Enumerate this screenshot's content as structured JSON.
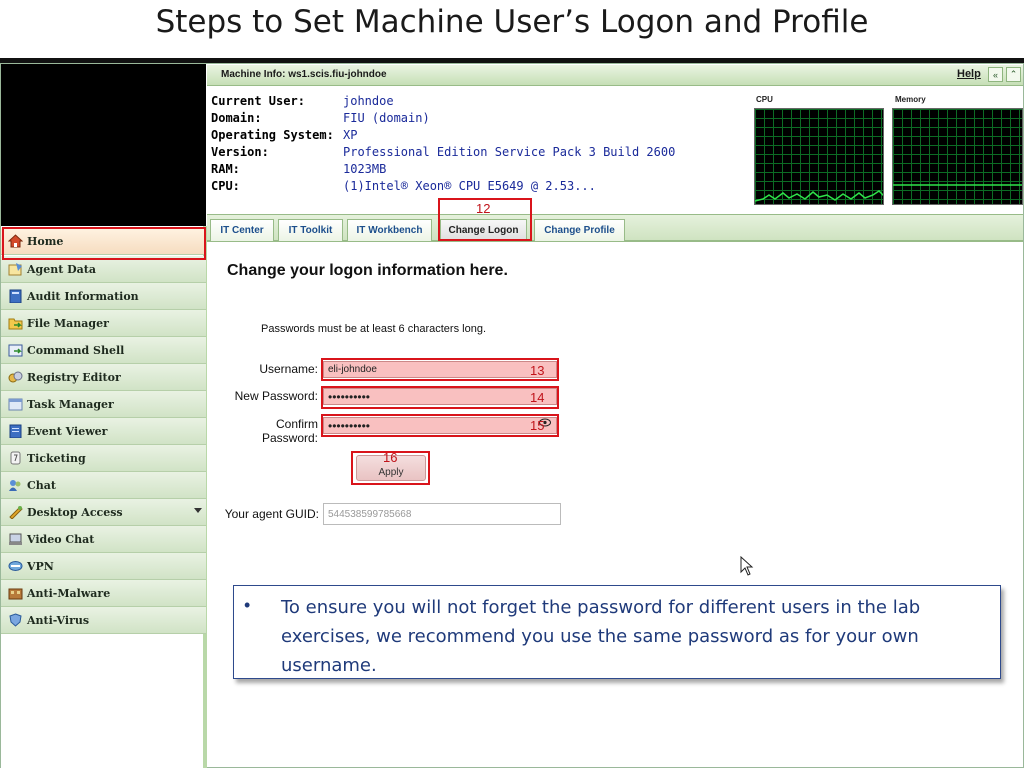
{
  "slide": {
    "title": "Steps to Set Machine User’s Logon and Profile"
  },
  "header": {
    "machine_info": "Machine Info: ws1.scis.fiu-johndoe",
    "help": "Help",
    "collapse_glyph": "«",
    "up_glyph": "⌃"
  },
  "info": [
    {
      "key": "Current User:",
      "value": "johndoe"
    },
    {
      "key": "Domain:",
      "value": "FIU (domain)"
    },
    {
      "key": "Operating System:",
      "value": "XP"
    },
    {
      "key": "Version:",
      "value": "Professional Edition Service Pack 3 Build 2600"
    },
    {
      "key": "RAM:",
      "value": "1023MB"
    },
    {
      "key": "CPU:",
      "value": "(1)Intel® Xeon® CPU E5649 @ 2.53..."
    }
  ],
  "graphs": {
    "cpu_label": "CPU",
    "memory_label": "Memory"
  },
  "tabs": [
    {
      "label": "IT Center"
    },
    {
      "label": "IT Toolkit"
    },
    {
      "label": "IT Workbench"
    },
    {
      "label": "Change Logon",
      "active": true
    },
    {
      "label": "Change Profile"
    }
  ],
  "sidebar": {
    "items": [
      {
        "label": "Home",
        "icon": "home-icon"
      },
      {
        "label": "Agent Data",
        "icon": "agent-data-icon"
      },
      {
        "label": "Audit Information",
        "icon": "audit-icon"
      },
      {
        "label": "File Manager",
        "icon": "folder-icon"
      },
      {
        "label": "Command Shell",
        "icon": "shell-icon"
      },
      {
        "label": "Registry Editor",
        "icon": "registry-icon"
      },
      {
        "label": "Task Manager",
        "icon": "task-icon"
      },
      {
        "label": "Event Viewer",
        "icon": "event-icon"
      },
      {
        "label": "Ticketing",
        "icon": "ticket-icon"
      },
      {
        "label": "Chat",
        "icon": "chat-icon"
      },
      {
        "label": "Desktop Access",
        "icon": "desktop-access-icon"
      },
      {
        "label": "Video Chat",
        "icon": "video-chat-icon"
      },
      {
        "label": "VPN",
        "icon": "vpn-icon"
      },
      {
        "label": "Anti-Malware",
        "icon": "anti-malware-icon"
      },
      {
        "label": "Anti-Virus",
        "icon": "anti-virus-icon"
      }
    ]
  },
  "form": {
    "heading": "Change your logon information here.",
    "note": "Passwords must be at least 6 characters long.",
    "username_label": "Username:",
    "username_value": "eli-johndoe",
    "new_password_label": "New Password:",
    "new_password_value": "••••••••••",
    "confirm_label_1": "Confirm",
    "confirm_label_2": "Password:",
    "confirm_value": "••••••••••",
    "apply_label": "Apply",
    "guid_label": "Your agent GUID:",
    "guid_value": "544538599785668"
  },
  "annotations": {
    "n12": "12",
    "n13": "13",
    "n14": "14",
    "n15": "15",
    "n16": "16"
  },
  "callout": {
    "bullet": "•",
    "text": "To ensure you will not forget the password for different users in the lab exercises, we recommend you use the same password as for your own username."
  }
}
